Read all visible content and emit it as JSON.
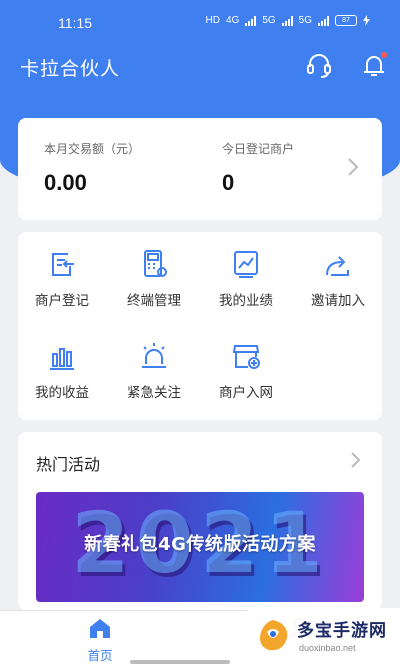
{
  "status_bar": {
    "time": "11:15",
    "network_1": "HD",
    "network_2": "4G",
    "network_3": "5G",
    "network_4": "5G",
    "battery": "87"
  },
  "header": {
    "title": "卡拉合伙人",
    "support_icon": "headset-icon",
    "notification_icon": "bell-icon"
  },
  "stats": {
    "monthly_label": "本月交易额（元）",
    "monthly_value": "0.00",
    "today_label": "今日登记商户",
    "today_value": "0"
  },
  "menu": {
    "items": [
      {
        "label": "商户登记",
        "icon": "merchant-register-icon"
      },
      {
        "label": "终端管理",
        "icon": "terminal-manage-icon"
      },
      {
        "label": "我的业绩",
        "icon": "performance-chart-icon"
      },
      {
        "label": "邀请加入",
        "icon": "invite-share-icon"
      },
      {
        "label": "我的收益",
        "icon": "earnings-bar-icon"
      },
      {
        "label": "紧急关注",
        "icon": "alarm-light-icon"
      },
      {
        "label": "商户入网",
        "icon": "store-network-icon"
      }
    ]
  },
  "activity": {
    "title": "热门活动",
    "banner_year": "2021",
    "banner_text": "新春礼包4G传统版活动方案"
  },
  "bottom_nav": {
    "home_label": "首页"
  },
  "watermark": {
    "title": "多宝手游网",
    "url": "duoxinbao.net"
  },
  "colors": {
    "primary": "#3f7ff0",
    "background": "#eef0f4",
    "badge": "#ff5a4e"
  }
}
